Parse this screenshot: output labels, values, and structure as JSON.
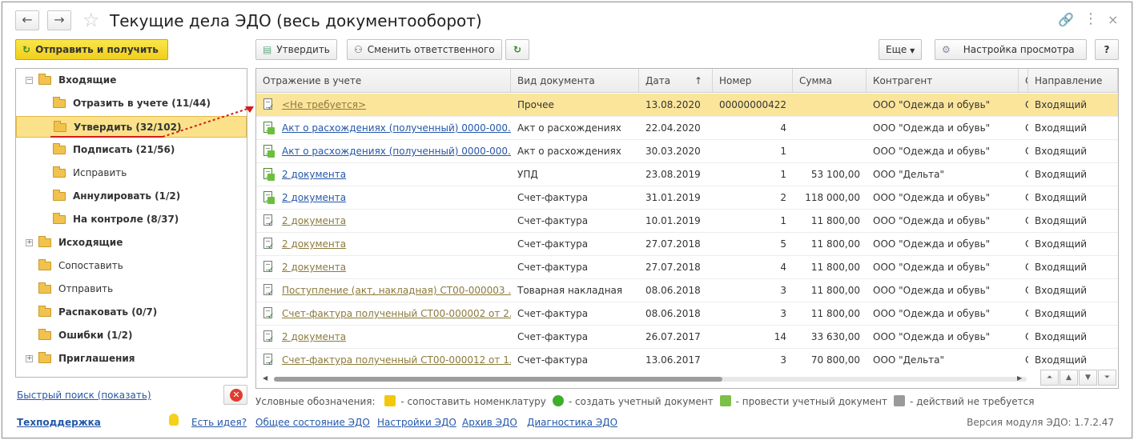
{
  "window": {
    "title": "Текущие дела ЭДО (весь документооборот)",
    "back_icon": "←",
    "forward_icon": "→"
  },
  "left": {
    "send_button": "Отправить и получить",
    "tree": [
      {
        "label": "Входящие",
        "bold": true,
        "level": 0,
        "expander": "minus"
      },
      {
        "label": "Отразить в учете (11/44)",
        "bold": true,
        "level": 1
      },
      {
        "label": "Утвердить (32/102)",
        "bold": true,
        "level": 1,
        "selected": true
      },
      {
        "label": "Подписать (21/56)",
        "bold": true,
        "level": 1
      },
      {
        "label": "Исправить",
        "bold": false,
        "level": 1
      },
      {
        "label": "Аннулировать (1/2)",
        "bold": true,
        "level": 1
      },
      {
        "label": "На контроле (8/37)",
        "bold": true,
        "level": 1
      },
      {
        "label": "Исходящие",
        "bold": true,
        "level": 0,
        "expander": "plus"
      },
      {
        "label": "Сопоставить",
        "bold": false,
        "level": 0
      },
      {
        "label": "Отправить",
        "bold": false,
        "level": 0
      },
      {
        "label": "Распаковать (0/7)",
        "bold": true,
        "level": 0
      },
      {
        "label": "Ошибки (1/2)",
        "bold": true,
        "level": 0
      },
      {
        "label": "Приглашения",
        "bold": true,
        "level": 0,
        "expander": "plus"
      }
    ],
    "quick_search": "Быстрый поиск (показать)"
  },
  "toolbar": {
    "approve": "Утвердить",
    "change_responsible": "Сменить ответственного",
    "more": "Еще",
    "view_settings": "Настройка просмотра",
    "help": "?"
  },
  "grid": {
    "columns": [
      "Отражение в учете",
      "Вид документа",
      "Дата",
      "Номер",
      "Сумма",
      "Контрагент",
      "С",
      "Направление"
    ],
    "sort_indicator": "↑",
    "rows": [
      {
        "ref": "<Не требуется>",
        "type": "Прочее",
        "date": "13.08.2020",
        "number": "00000000422",
        "sum": "",
        "contractor": "ООО \"Одежда и обувь\"",
        "c": "С",
        "direction": "Входящий",
        "icon": "ok",
        "link": "brown",
        "selected": true
      },
      {
        "ref": "Акт о расхождениях (полученный) 0000-000...",
        "type": "Акт о расхождениях",
        "date": "22.04.2020",
        "number": "4",
        "sum": "",
        "contractor": "ООО \"Одежда и обувь\"",
        "c": "С",
        "direction": "Входящий",
        "icon": "green",
        "link": "blue"
      },
      {
        "ref": "Акт о расхождениях (полученный) 0000-000...",
        "type": "Акт о расхождениях",
        "date": "30.03.2020",
        "number": "1",
        "sum": "",
        "contractor": "ООО \"Одежда и обувь\"",
        "c": "С",
        "direction": "Входящий",
        "icon": "green",
        "link": "blue"
      },
      {
        "ref": "2 документа",
        "type": "УПД",
        "date": "23.08.2019",
        "number": "1",
        "sum": "53 100,00",
        "contractor": "ООО \"Дельта\"",
        "c": "С",
        "direction": "Входящий",
        "icon": "green",
        "link": "blue"
      },
      {
        "ref": "2 документа",
        "type": "Счет-фактура",
        "date": "31.01.2019",
        "number": "2",
        "sum": "118 000,00",
        "contractor": "ООО \"Одежда и обувь\"",
        "c": "С",
        "direction": "Входящий",
        "icon": "green",
        "link": "blue"
      },
      {
        "ref": "2 документа",
        "type": "Счет-фактура",
        "date": "10.01.2019",
        "number": "1",
        "sum": "11 800,00",
        "contractor": "ООО \"Одежда и обувь\"",
        "c": "С",
        "direction": "Входящий",
        "icon": "ok",
        "link": "brown"
      },
      {
        "ref": "2 документа",
        "type": "Счет-фактура",
        "date": "27.07.2018",
        "number": "5",
        "sum": "11 800,00",
        "contractor": "ООО \"Одежда и обувь\"",
        "c": "С",
        "direction": "Входящий",
        "icon": "ok",
        "link": "brown"
      },
      {
        "ref": "2 документа",
        "type": "Счет-фактура",
        "date": "27.07.2018",
        "number": "4",
        "sum": "11 800,00",
        "contractor": "ООО \"Одежда и обувь\"",
        "c": "С",
        "direction": "Входящий",
        "icon": "ok",
        "link": "brown"
      },
      {
        "ref": "Поступление (акт, накладная) СТ00-000003 ...",
        "type": "Товарная накладная",
        "date": "08.06.2018",
        "number": "3",
        "sum": "11 800,00",
        "contractor": "ООО \"Одежда и обувь\"",
        "c": "С",
        "direction": "Входящий",
        "icon": "ok",
        "link": "brown"
      },
      {
        "ref": "Счет-фактура полученный СТ00-000002 от 2...",
        "type": "Счет-фактура",
        "date": "08.06.2018",
        "number": "3",
        "sum": "11 800,00",
        "contractor": "ООО \"Одежда и обувь\"",
        "c": "С",
        "direction": "Входящий",
        "icon": "ok",
        "link": "brown"
      },
      {
        "ref": "2 документа",
        "type": "Счет-фактура",
        "date": "26.07.2017",
        "number": "14",
        "sum": "33 630,00",
        "contractor": "ООО \"Одежда и обувь\"",
        "c": "С",
        "direction": "Входящий",
        "icon": "ok",
        "link": "brown"
      },
      {
        "ref": "Счет-фактура полученный СТ00-000012 от 1...",
        "type": "Счет-фактура",
        "date": "13.06.2017",
        "number": "3",
        "sum": "70 800,00",
        "contractor": "ООО \"Дельта\"",
        "c": "С",
        "direction": "Входящий",
        "icon": "ok",
        "link": "brown"
      }
    ]
  },
  "legend": {
    "title": "Условные обозначения:",
    "items": [
      {
        "text": "- сопоставить номенклатуру",
        "color": "#f2c80f",
        "icon": "warning-icon"
      },
      {
        "text": "- создать учетный документ",
        "color": "#3fae2a",
        "icon": "plus-circle-icon"
      },
      {
        "text": "- провести учетный документ",
        "color": "#7cc04a",
        "icon": "post-document-icon"
      },
      {
        "text": "- действий не требуется",
        "color": "#9a9a9a",
        "icon": "no-action-icon"
      }
    ]
  },
  "footer": {
    "techsupport": "Техподдержка",
    "idea": "Есть идея?",
    "status": "Общее состояние ЭДО",
    "settings": "Настройки ЭДО",
    "archive": "Архив ЭДО",
    "diagnostics": "Диагностика ЭДО",
    "version": "Версия модуля ЭДО: 1.7.2.47"
  },
  "colors": {
    "accent_yellow": "#f1cf1a",
    "selection": "#fbe28a",
    "link_blue": "#2457a8",
    "link_brown": "#8c7a3c"
  }
}
